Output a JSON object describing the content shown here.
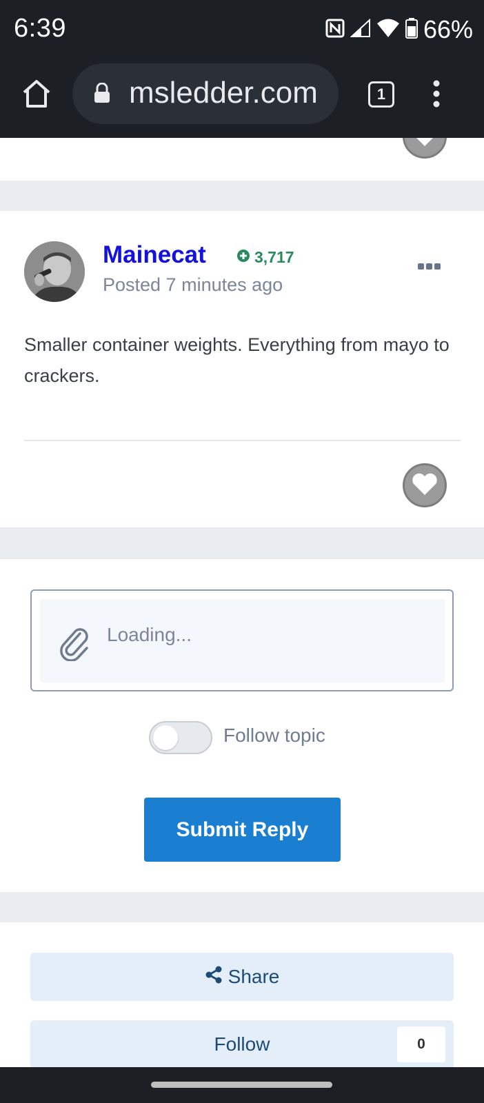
{
  "status_bar": {
    "time": "6:39",
    "battery": "66%",
    "icons": [
      "nfc-icon",
      "signal-icon",
      "wifi-icon",
      "battery-icon"
    ]
  },
  "browser": {
    "url": "msledder.com",
    "tab_count": "1",
    "icons": [
      "home-icon",
      "lock-icon",
      "tabs-icon",
      "menu-icon"
    ]
  },
  "post": {
    "author": "Mainecat",
    "reputation": "3,717",
    "posted": "Posted 7 minutes ago",
    "body": "Smaller container weights. Everything from mayo to crackers."
  },
  "reply": {
    "editor_placeholder": "Loading...",
    "follow_topic_label": "Follow topic",
    "follow_topic_on": false,
    "submit_label": "Submit Reply"
  },
  "actions": {
    "share_label": "Share",
    "follow_label": "Follow",
    "follow_count": "0"
  },
  "colors": {
    "author": "#1212d8",
    "reputation": "#2a8a5e",
    "submit_button": "#1a7fd1",
    "action_button_bg": "#e3eef9"
  }
}
